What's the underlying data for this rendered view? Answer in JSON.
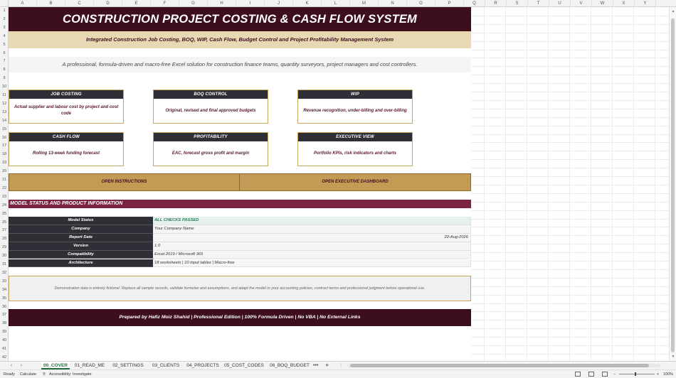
{
  "columns": [
    "A",
    "B",
    "C",
    "D",
    "E",
    "F",
    "G",
    "H",
    "I",
    "J",
    "K",
    "L",
    "M",
    "N",
    "O",
    "P",
    "Q",
    "R",
    "S",
    "T",
    "U",
    "V",
    "W",
    "X",
    "Y"
  ],
  "rows": [
    "1",
    "2",
    "3",
    "4",
    "5",
    "6",
    "7",
    "8",
    "9",
    "10",
    "11",
    "12",
    "13",
    "14",
    "15",
    "16",
    "17",
    "18",
    "19",
    "20",
    "21",
    "22",
    "23",
    "24",
    "25",
    "26",
    "27",
    "28",
    "29",
    "30",
    "31",
    "32",
    "33",
    "34",
    "35",
    "36",
    "37",
    "38",
    "39",
    "40",
    "41",
    "42"
  ],
  "cover": {
    "title": "CONSTRUCTION PROJECT COSTING & CASH FLOW SYSTEM",
    "subtitle": "Integrated Construction Job Costing, BOQ, WIP, Cash Flow, Budget Control and Project Profitability Management System",
    "description": "A professional, formula-driven and macro-free Excel solution for construction finance teams, quantity surveyors, project managers and cost controllers.",
    "cards": [
      {
        "title": "JOB COSTING",
        "body": "Actual supplier and labour cost by project and cost code"
      },
      {
        "title": "BOQ CONTROL",
        "body": "Original, revised and final approved budgets"
      },
      {
        "title": "WIP",
        "body": "Revenue recognition, under-billing and over-billing"
      },
      {
        "title": "CASH FLOW",
        "body": "Rolling 13-week funding forecast"
      },
      {
        "title": "PROFITABILITY",
        "body": "EAC, forecast gross profit and margin"
      },
      {
        "title": "EXECUTIVE VIEW",
        "body": "Portfolio KPIs, risk indicators and charts"
      }
    ],
    "buttons": {
      "instructions": "OPEN INSTRUCTIONS",
      "dashboard": "OPEN EXECUTIVE DASHBOARD"
    },
    "section_title": "MODEL STATUS AND PRODUCT INFORMATION",
    "info": [
      {
        "label": "Model Status",
        "value": "ALL CHECKS PASSED"
      },
      {
        "label": "Company",
        "value": "Your Company Name"
      },
      {
        "label": "Report Date",
        "value": "22-Aug-2026"
      },
      {
        "label": "Version",
        "value": "1.0"
      },
      {
        "label": "Compatibility",
        "value": "Excel 2019 / Microsoft 365"
      },
      {
        "label": "Architecture",
        "value": "18 worksheets | 10 input tables | Macro-free"
      }
    ],
    "disclaimer": "Demonstration data is entirely fictional. Replace all sample records, validate formulas and assumptions, and adapt the model to your accounting policies, contract terms and professional judgment before operational use.",
    "footer": "Prepared by Hafiz Moiz Shahid | Professional Edition | 100% Formula Driven | No VBA | No External Links"
  },
  "tabs": [
    "00_COVER",
    "01_READ_ME",
    "02_SETTINGS",
    "03_CLIENTS",
    "04_PROJECTS",
    "05_COST_CODES",
    "06_BOQ_BUDGET"
  ],
  "active_tab": "00_COVER",
  "tab_more": "•••",
  "tab_add": "+",
  "status": {
    "ready": "Ready",
    "calculate": "Calculate",
    "accessibility": "Accessibility: Investigate",
    "zoom": "100%",
    "zoom_minus": "−",
    "zoom_plus": "+"
  },
  "colors": {
    "banner": "#3d0f1c",
    "subbanner": "#e8d9b5",
    "card_header": "#2f2f37",
    "card_border": "#c9a45c",
    "nav_bar": "#c49b54",
    "section": "#7a2444",
    "ok_text": "#2e7d5b",
    "active_tab": "#1d6b3a"
  }
}
